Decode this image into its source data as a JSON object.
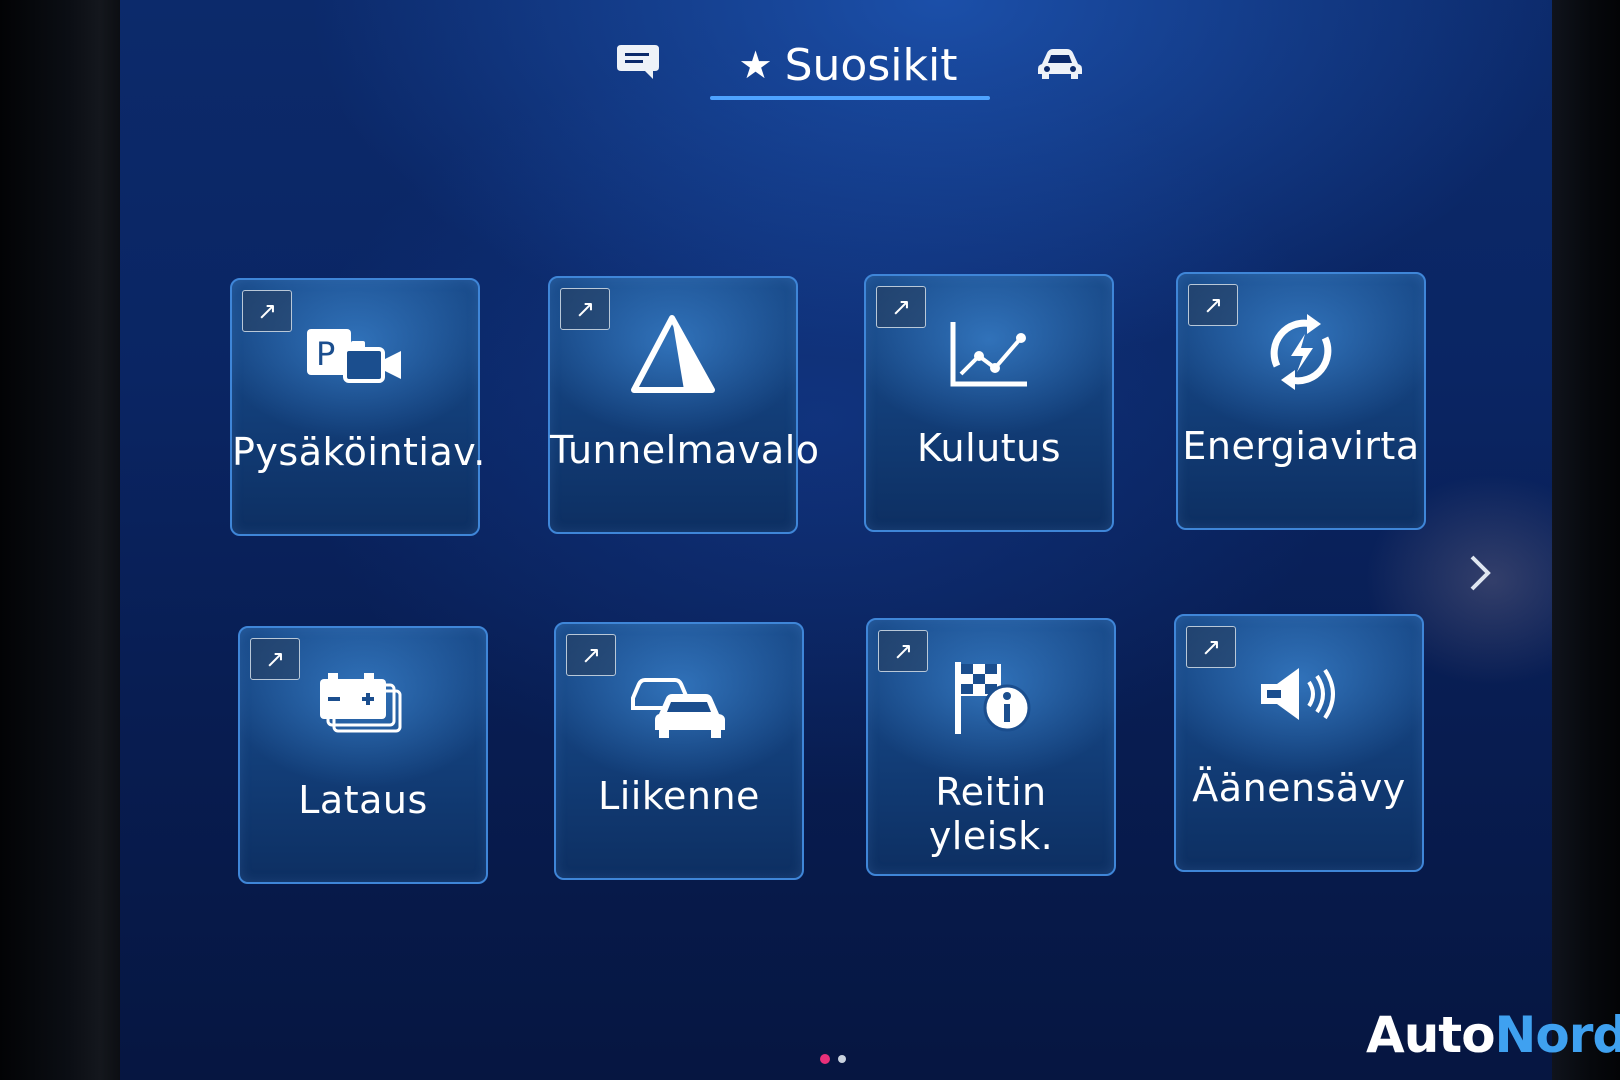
{
  "header": {
    "tabs": [
      {
        "id": "messages",
        "icon": "message-bubble-icon"
      },
      {
        "id": "favorites",
        "icon": "star-icon",
        "label": "Suosikit",
        "active": true
      },
      {
        "id": "vehicle",
        "icon": "car-icon"
      }
    ]
  },
  "tiles": [
    {
      "label": "Pysäköintiav.",
      "icon": "parking-camera-icon",
      "shortcut_icon": "arrow-up-right-icon"
    },
    {
      "label": "Tunnelmavalo",
      "icon": "ambient-light-pyramid-icon",
      "shortcut_icon": "arrow-up-right-icon"
    },
    {
      "label": "Kulutus",
      "icon": "line-chart-icon",
      "shortcut_icon": "arrow-up-right-icon"
    },
    {
      "label": "Energiavirta",
      "icon": "energy-flow-icon",
      "shortcut_icon": "arrow-up-right-icon"
    },
    {
      "label": "Lataus",
      "icon": "battery-charging-icon",
      "shortcut_icon": "arrow-up-right-icon"
    },
    {
      "label": "Liikenne",
      "icon": "traffic-cars-icon",
      "shortcut_icon": "arrow-up-right-icon"
    },
    {
      "label": "Reitin yleisk.",
      "icon": "route-flag-info-icon",
      "shortcut_icon": "arrow-up-right-icon"
    },
    {
      "label": "Äänensävy",
      "icon": "speaker-icon",
      "shortcut_icon": "arrow-up-right-icon"
    }
  ],
  "pagination": {
    "pages": 2,
    "current": 1
  },
  "colors": {
    "accent": "#4ea3ff",
    "active_dot": "#e8307a",
    "logo_auto": "#ffffff",
    "logo_nord": "#3fa1f0"
  },
  "watermark": {
    "part1": "Auto",
    "part2": "Nord"
  }
}
